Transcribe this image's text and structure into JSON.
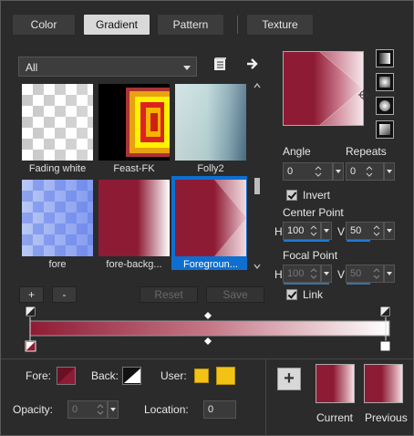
{
  "tabs": [
    {
      "label": "Color"
    },
    {
      "label": "Gradient"
    },
    {
      "label": "Pattern"
    },
    {
      "label": "Texture"
    }
  ],
  "category": {
    "selected": "All"
  },
  "thumbnails": [
    {
      "label": "Fading white"
    },
    {
      "label": "Feast-FK"
    },
    {
      "label": "Folly2"
    },
    {
      "label": "fore"
    },
    {
      "label": "fore-backg..."
    },
    {
      "label": "Foregroun..."
    }
  ],
  "list_buttons": {
    "add": "+",
    "remove": "-",
    "reset": "Reset",
    "save": "Save"
  },
  "controls": {
    "angle_label": "Angle",
    "angle_value": "0",
    "repeats_label": "Repeats",
    "repeats_value": "0",
    "invert_label": "Invert",
    "center_point_label": "Center Point",
    "center_h_label": "H",
    "center_h_value": "100",
    "center_v_label": "V",
    "center_v_value": "50",
    "focal_point_label": "Focal Point",
    "focal_h_label": "H",
    "focal_h_value": "100",
    "focal_v_label": "V",
    "focal_v_value": "50",
    "link_label": "Link"
  },
  "bottom": {
    "fore_label": "Fore:",
    "back_label": "Back:",
    "user_label": "User:",
    "opacity_label": "Opacity:",
    "opacity_value": "0",
    "location_label": "Location:",
    "location_value": "0",
    "current_label": "Current",
    "previous_label": "Previous",
    "add_symbol": "+"
  },
  "colors": {
    "maroon": "#8e1b34",
    "user_yellow": "#f2c315",
    "selection_blue": "#0e6fd1"
  }
}
